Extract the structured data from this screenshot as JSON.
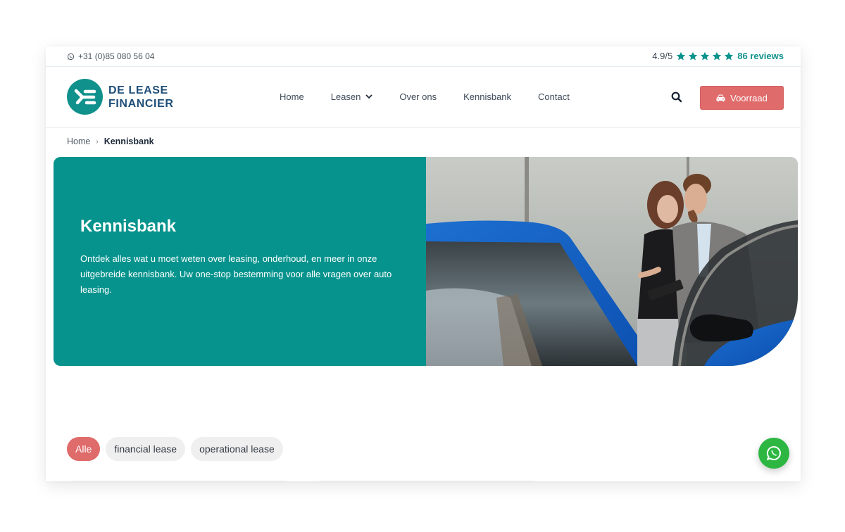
{
  "topbar": {
    "phone_icon": "whatsapp-icon",
    "phone": "+31 (0)85 080 56 04",
    "rating_score": "4.9/5",
    "rating_stars": 5,
    "rating_reviews": "86 reviews"
  },
  "header": {
    "logo_line1": "DE LEASE",
    "logo_line2": "FINANCIER",
    "nav": [
      {
        "label": "Home"
      },
      {
        "label": "Leasen",
        "has_dropdown": true
      },
      {
        "label": "Over ons"
      },
      {
        "label": "Kennisbank"
      },
      {
        "label": "Contact"
      }
    ],
    "search_icon": "search-icon",
    "stock_button": "Voorraad",
    "stock_icon": "car-icon"
  },
  "breadcrumb": {
    "home": "Home",
    "separator": "›",
    "current": "Kennisbank"
  },
  "hero": {
    "title": "Kennisbank",
    "text": "Ontdek alles wat u moet weten over leasing, onderhoud, en meer in onze uitgebreide kennisbank. Uw one-stop bestemming voor alle vragen over auto leasing.",
    "image_alt": "Man en vrouw bij een blauwe auto met open portier"
  },
  "filters": [
    {
      "label": "Alle",
      "active": true
    },
    {
      "label": "financial lease",
      "active": false
    },
    {
      "label": "operational lease",
      "active": false
    }
  ],
  "colors": {
    "brand_teal": "#06938d",
    "accent_red": "#e06b6b",
    "whatsapp_green": "#2db742",
    "logo_navy": "#1f4e78"
  }
}
